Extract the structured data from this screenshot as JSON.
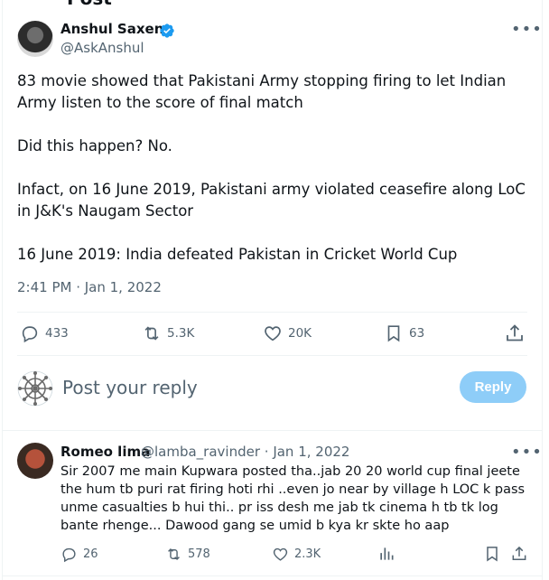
{
  "header": {
    "title": "Post"
  },
  "tweet": {
    "author_name": "Anshul Saxena",
    "handle": "@AskAnshul",
    "text": "83 movie showed that Pakistani Army stopping firing to let Indian Army listen to the score of final match\n\nDid this happen? No.\n\nInfact, on 16 June 2019, Pakistani army violated ceasefire along LoC in J&K's Naugam Sector\n\n16 June 2019: India defeated Pakistan in Cricket World Cup",
    "timestamp": "2:41 PM · Jan 1, 2022",
    "stats": {
      "replies": "433",
      "reposts": "5.3K",
      "likes": "20K",
      "bookmarks": "63"
    }
  },
  "composer": {
    "placeholder": "Post your reply",
    "reply_button": "Reply"
  },
  "reply": {
    "author_name": "Romeo lima",
    "meta": "@lamba_ravinder · Jan 1, 2022",
    "text": "Sir 2007 me main Kupwara posted tha..jab 20 20 world cup final jeete the hum tb puri rat firing hoti rhi ..even jo near by village h LOC k pass unme casualties b hui thi.. pr iss desh me jab tk cinema h tb tk log bante rhenge... Dawood gang se umid b kya kr skte ho aap",
    "stats": {
      "replies": "26",
      "reposts": "578",
      "likes": "2.3K"
    }
  },
  "colors": {
    "accent": "#1d9bf0",
    "reply_button_bg": "#8ecdf8",
    "muted": "#536471"
  }
}
